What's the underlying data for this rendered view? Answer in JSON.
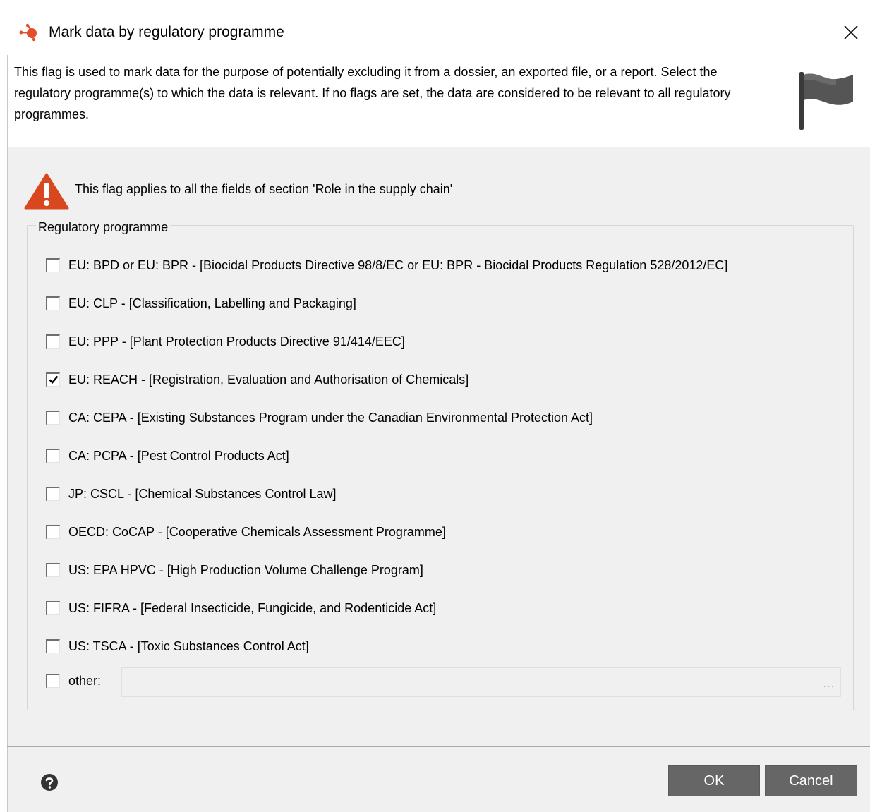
{
  "dialog": {
    "title": "Mark data by regulatory programme",
    "description": "This flag is used to mark data for the purpose of potentially excluding it from a dossier, an exported file, or a report. Select the regulatory programme(s) to which the data is relevant. If no flags are set, the data are considered to be relevant to all regulatory programmes.",
    "warning": "This flag applies to all the fields of section 'Role in the supply chain'",
    "group_title": "Regulatory programme",
    "programmes": [
      {
        "label": "EU: BPD or EU: BPR - [Biocidal Products Directive 98/8/EC or EU: BPR - Biocidal Products Regulation 528/2012/EC]",
        "checked": false
      },
      {
        "label": "EU: CLP - [Classification, Labelling and Packaging]",
        "checked": false
      },
      {
        "label": "EU: PPP - [Plant Protection Products Directive 91/414/EEC]",
        "checked": false
      },
      {
        "label": "EU: REACH - [Registration, Evaluation and Authorisation of Chemicals]",
        "checked": true
      },
      {
        "label": "CA: CEPA - [Existing Substances Program under the Canadian Environmental Protection Act]",
        "checked": false
      },
      {
        "label": "CA: PCPA - [Pest Control Products Act]",
        "checked": false
      },
      {
        "label": "JP: CSCL - [Chemical Substances Control Law]",
        "checked": false
      },
      {
        "label": "OECD: CoCAP - [Cooperative Chemicals Assessment Programme]",
        "checked": false
      },
      {
        "label": "US: EPA HPVC - [High Production Volume Challenge Program]",
        "checked": false
      },
      {
        "label": "US: FIFRA - [Federal Insecticide, Fungicide, and Rodenticide Act]",
        "checked": false
      },
      {
        "label": "US: TSCA - [Toxic Substances Control Act]",
        "checked": false
      }
    ],
    "other": {
      "label": "other:",
      "checked": false,
      "value": "",
      "ellipsis": "..."
    },
    "ok_label": "OK",
    "cancel_label": "Cancel"
  },
  "colors": {
    "button_bg": "#666666",
    "button_text": "#ffffff",
    "body_bg": "#f0f0f0",
    "warning": "#d9471f",
    "app_icon": "#e2502b"
  }
}
